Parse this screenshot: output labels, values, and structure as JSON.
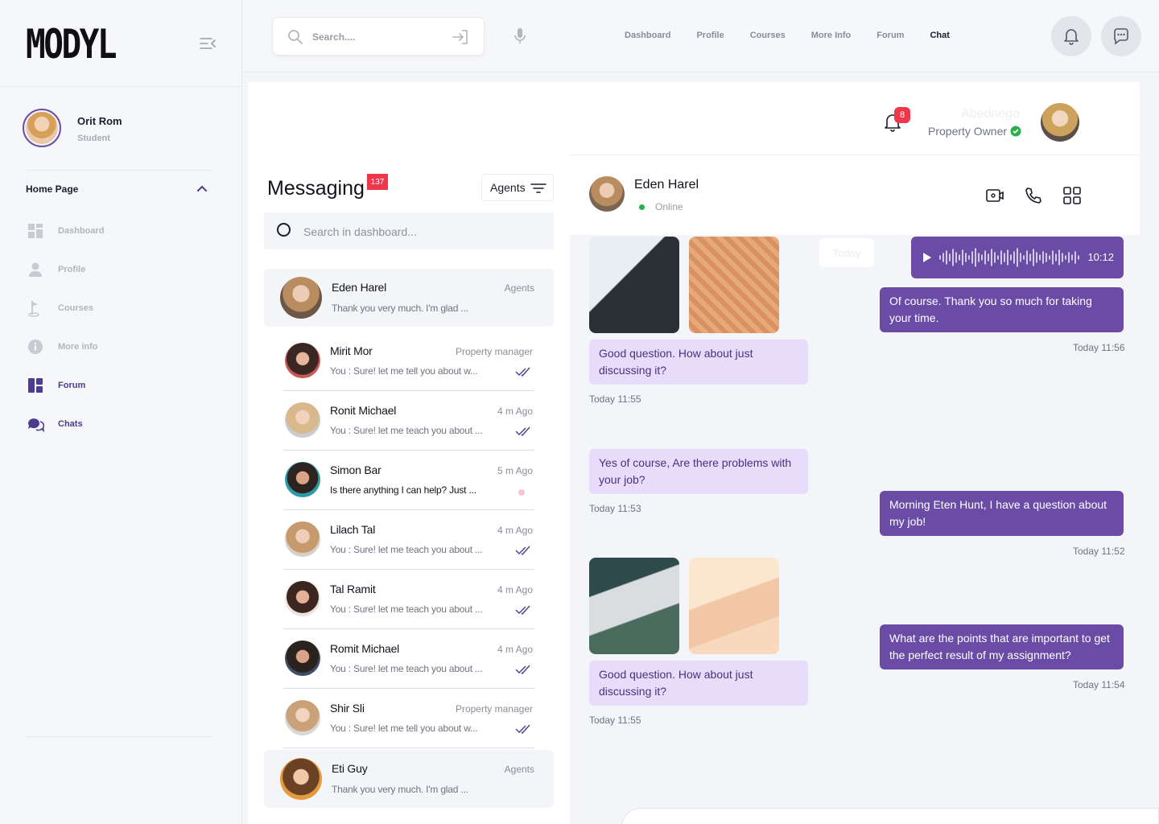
{
  "app": {
    "logo": "MODYL"
  },
  "user": {
    "name": "Orit Rom",
    "role": "Student"
  },
  "sidebar": {
    "section": "Home Page",
    "items": [
      {
        "label": "Dashboard",
        "icon": "dashboard-icon"
      },
      {
        "label": "Profile",
        "icon": "user-icon"
      },
      {
        "label": "Courses",
        "icon": "flag-icon"
      },
      {
        "label": "More info",
        "icon": "info-icon"
      },
      {
        "label": "Forum",
        "icon": "forum-icon"
      },
      {
        "label": "Chats",
        "icon": "chat-icon"
      }
    ]
  },
  "topbar": {
    "search_placeholder": "Search....",
    "nav": [
      "Dashboard",
      "Profile",
      "Courses",
      "More Info",
      "Forum",
      "Chat"
    ],
    "active_nav": "Chat"
  },
  "header": {
    "notification_count": "8",
    "user_name": "Abednego",
    "user_role": "Property Owner"
  },
  "messaging": {
    "title": "Messaging",
    "badge": "137",
    "filter_label": "Agents",
    "search_placeholder": "Search in dashboard...",
    "conversations": [
      {
        "name": "Eden Harel",
        "time": "Agents",
        "preview": "Thank you very much. I'm glad ..."
      },
      {
        "name": "Mirit Mor",
        "time": "Property manager",
        "preview": "You : Sure! let me tell you about w..."
      },
      {
        "name": "Ronit Michael",
        "time": "4 m Ago",
        "preview": "You : Sure! let me teach you about ..."
      },
      {
        "name": "Simon Bar",
        "time": "5 m Ago",
        "preview": "Is there anything I can help? Just ..."
      },
      {
        "name": "Lilach Tal",
        "time": "4 m Ago",
        "preview": "You : Sure! let me teach you about ..."
      },
      {
        "name": "Tal Ramit",
        "time": "4 m Ago",
        "preview": "You : Sure! let me teach you about ..."
      },
      {
        "name": "Romit Michael",
        "time": "4 m Ago",
        "preview": "You : Sure! let me teach you about ..."
      },
      {
        "name": "Shir Sli",
        "time": "Property manager",
        "preview": "You : Sure! let me tell you about w..."
      },
      {
        "name": "Eti Guy",
        "time": "Agents",
        "preview": "Thank you very much. I'm glad ..."
      }
    ]
  },
  "chat": {
    "contact_name": "Eden Harel",
    "contact_status": "Online",
    "day_chip": "Today",
    "voice_duration": "10:12",
    "incoming": [
      {
        "text": "Good question. How about just discussing it?",
        "time": "Today 11:55"
      },
      {
        "text": "Yes of course, Are there problems with your job?",
        "time": "Today 11:53"
      },
      {
        "text": "Good question. How about just discussing it?",
        "time": "Today 11:55"
      }
    ],
    "outgoing": [
      {
        "text": "Of course. Thank you so much for taking your time.",
        "time": "Today 11:56"
      },
      {
        "text": "Morning Eten Hunt, I have a question about my job!",
        "time": "Today 11:52"
      },
      {
        "text": "What are the points that are important to get the perfect result of my assignment?",
        "time": "Today 11:54"
      }
    ]
  },
  "colors": {
    "accent": "#6a4ca6",
    "incoming_bubble": "#e8dcfb",
    "badge": "#f0364a",
    "online": "#2ab04a"
  }
}
